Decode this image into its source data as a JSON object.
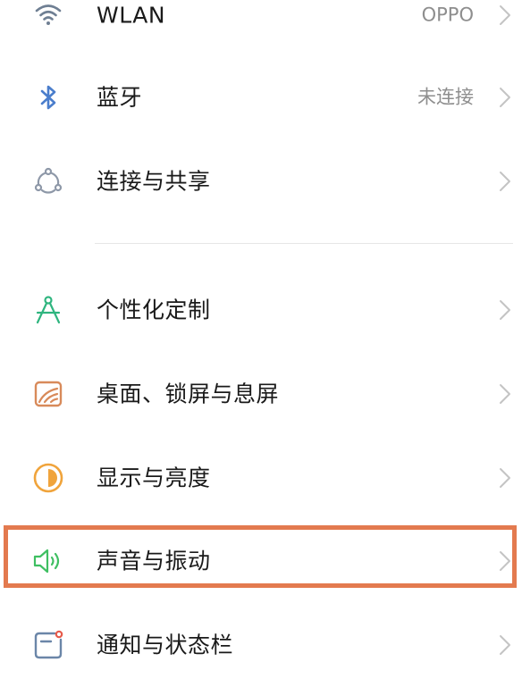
{
  "settings": {
    "items": [
      {
        "key": "wlan",
        "label": "WLAN",
        "value": "OPPO",
        "icon": "wifi-icon"
      },
      {
        "key": "bluetooth",
        "label": "蓝牙",
        "value": "未连接",
        "icon": "bluetooth-icon"
      },
      {
        "key": "connection-sharing",
        "label": "连接与共享",
        "value": "",
        "icon": "connection-share-icon"
      },
      {
        "key": "personalization",
        "label": "个性化定制",
        "value": "",
        "icon": "compass-icon"
      },
      {
        "key": "home-lock-screen",
        "label": "桌面、锁屏与息屏",
        "value": "",
        "icon": "wallpaper-icon"
      },
      {
        "key": "display-brightness",
        "label": "显示与亮度",
        "value": "",
        "icon": "brightness-icon"
      },
      {
        "key": "sound-vibration",
        "label": "声音与振动",
        "value": "",
        "icon": "speaker-icon"
      },
      {
        "key": "notification-status-bar",
        "label": "通知与状态栏",
        "value": "",
        "icon": "notification-icon"
      }
    ]
  },
  "colors": {
    "wifi": "#6f7f93",
    "bluetooth": "#4b7ecc",
    "connection": "#8e98a8",
    "personalization": "#2fb57f",
    "wallpaper": "#d88a5a",
    "brightness": "#f0a43c",
    "sound": "#3fbf62",
    "notification": "#6b86a8",
    "notification_dot": "#e65a4a",
    "highlight_border": "#e37a4f"
  }
}
